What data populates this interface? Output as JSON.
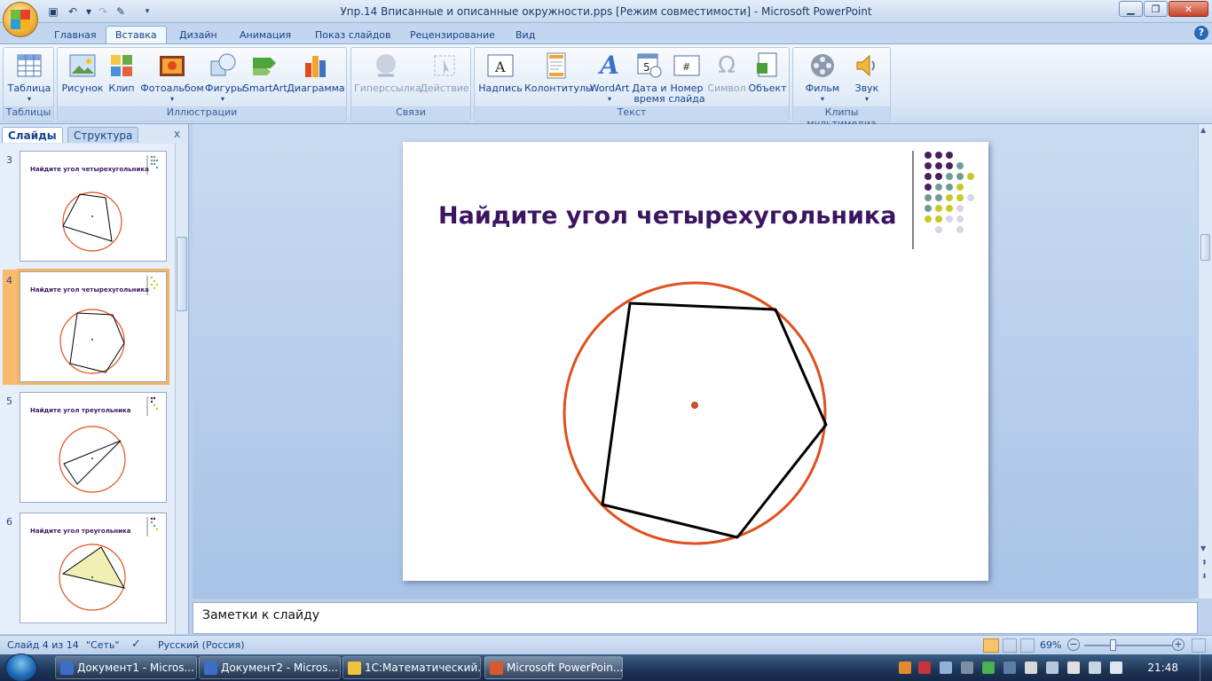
{
  "window": {
    "title": "Упр.14 Вписанные и описанные окружности.pps [Режим совместимости] - Microsoft PowerPoint"
  },
  "tabs": [
    "Главная",
    "Вставка",
    "Дизайн",
    "Анимация",
    "Показ слайдов",
    "Рецензирование",
    "Вид"
  ],
  "active_tab": "Вставка",
  "ribbon": {
    "groups": {
      "tables": "Таблицы",
      "illustrations": "Иллюстрации",
      "links": "Связи",
      "text": "Текст",
      "media": "Клипы мультимедиа"
    },
    "buttons": {
      "table": "Таблица",
      "picture": "Рисунок",
      "clip": "Клип",
      "photoalbum": "Фотоальбом",
      "shapes": "Фигуры",
      "smartart": "SmartArt",
      "chart": "Диаграмма",
      "hyperlink": "Гиперссылка",
      "action": "Действие",
      "textbox": "Надпись",
      "header_footer": "Колонтитулы",
      "wordart": "WordArt",
      "datetime_1": "Дата и",
      "datetime_2": "время",
      "slidenum_1": "Номер",
      "slidenum_2": "слайда",
      "symbol": "Символ",
      "object": "Объект",
      "movie": "Фильм",
      "sound": "Звук"
    }
  },
  "panel": {
    "tab_slides": "Слайды",
    "tab_outline": "Структура",
    "close": "x"
  },
  "thumbnails": [
    {
      "num": "3",
      "title": "Найдите угол четырехугольника"
    },
    {
      "num": "4",
      "title": "Найдите угол четырехугольника"
    },
    {
      "num": "5",
      "title": "Найдите угол треугольника"
    },
    {
      "num": "6",
      "title": "Найдите угол треугольника"
    }
  ],
  "slide": {
    "title": "Найдите угол четырехугольника",
    "colors": {
      "title": "#3b1562",
      "circle": "#e0501e",
      "polygon": "#000000",
      "dot_purple": "#4a1d5e",
      "dot_teal": "#6f9a98",
      "dot_yellow": "#c8c826",
      "dot_lilac": "#d6d6e8"
    }
  },
  "notes": {
    "placeholder": "Заметки к слайду"
  },
  "status": {
    "slide_info": "Слайд 4 из 14",
    "theme": "\"Сеть\"",
    "language": "Русский (Россия)",
    "zoom": "69%",
    "zoom_value": 69
  },
  "taskbar": {
    "items": [
      "Документ1 - Micros...",
      "Документ2 - Micros...",
      "1С:Математический...",
      "Microsoft PowerPoin..."
    ],
    "clock": "21:48"
  }
}
